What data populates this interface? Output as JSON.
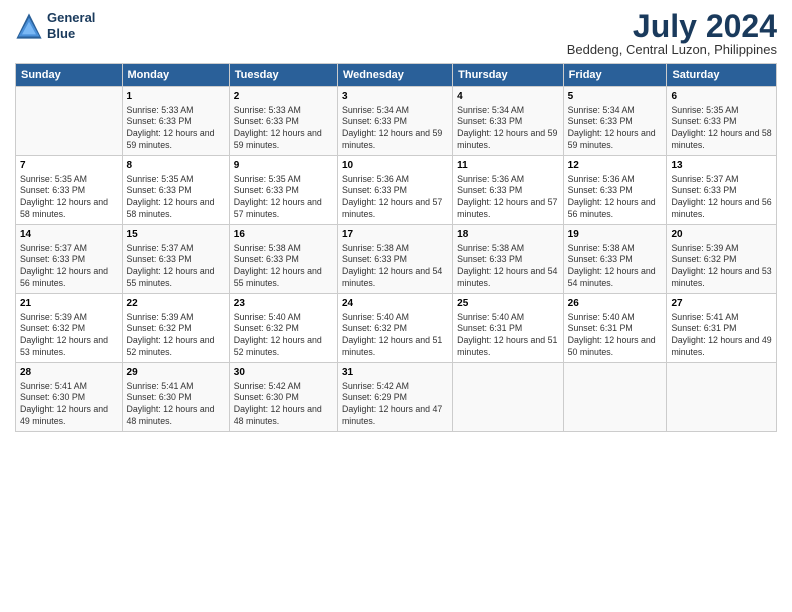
{
  "logo": {
    "line1": "General",
    "line2": "Blue"
  },
  "title": "July 2024",
  "subtitle": "Beddeng, Central Luzon, Philippines",
  "days_header": [
    "Sunday",
    "Monday",
    "Tuesday",
    "Wednesday",
    "Thursday",
    "Friday",
    "Saturday"
  ],
  "weeks": [
    [
      {
        "num": "",
        "sunrise": "",
        "sunset": "",
        "daylight": ""
      },
      {
        "num": "1",
        "sunrise": "Sunrise: 5:33 AM",
        "sunset": "Sunset: 6:33 PM",
        "daylight": "Daylight: 12 hours and 59 minutes."
      },
      {
        "num": "2",
        "sunrise": "Sunrise: 5:33 AM",
        "sunset": "Sunset: 6:33 PM",
        "daylight": "Daylight: 12 hours and 59 minutes."
      },
      {
        "num": "3",
        "sunrise": "Sunrise: 5:34 AM",
        "sunset": "Sunset: 6:33 PM",
        "daylight": "Daylight: 12 hours and 59 minutes."
      },
      {
        "num": "4",
        "sunrise": "Sunrise: 5:34 AM",
        "sunset": "Sunset: 6:33 PM",
        "daylight": "Daylight: 12 hours and 59 minutes."
      },
      {
        "num": "5",
        "sunrise": "Sunrise: 5:34 AM",
        "sunset": "Sunset: 6:33 PM",
        "daylight": "Daylight: 12 hours and 59 minutes."
      },
      {
        "num": "6",
        "sunrise": "Sunrise: 5:35 AM",
        "sunset": "Sunset: 6:33 PM",
        "daylight": "Daylight: 12 hours and 58 minutes."
      }
    ],
    [
      {
        "num": "7",
        "sunrise": "Sunrise: 5:35 AM",
        "sunset": "Sunset: 6:33 PM",
        "daylight": "Daylight: 12 hours and 58 minutes."
      },
      {
        "num": "8",
        "sunrise": "Sunrise: 5:35 AM",
        "sunset": "Sunset: 6:33 PM",
        "daylight": "Daylight: 12 hours and 58 minutes."
      },
      {
        "num": "9",
        "sunrise": "Sunrise: 5:35 AM",
        "sunset": "Sunset: 6:33 PM",
        "daylight": "Daylight: 12 hours and 57 minutes."
      },
      {
        "num": "10",
        "sunrise": "Sunrise: 5:36 AM",
        "sunset": "Sunset: 6:33 PM",
        "daylight": "Daylight: 12 hours and 57 minutes."
      },
      {
        "num": "11",
        "sunrise": "Sunrise: 5:36 AM",
        "sunset": "Sunset: 6:33 PM",
        "daylight": "Daylight: 12 hours and 57 minutes."
      },
      {
        "num": "12",
        "sunrise": "Sunrise: 5:36 AM",
        "sunset": "Sunset: 6:33 PM",
        "daylight": "Daylight: 12 hours and 56 minutes."
      },
      {
        "num": "13",
        "sunrise": "Sunrise: 5:37 AM",
        "sunset": "Sunset: 6:33 PM",
        "daylight": "Daylight: 12 hours and 56 minutes."
      }
    ],
    [
      {
        "num": "14",
        "sunrise": "Sunrise: 5:37 AM",
        "sunset": "Sunset: 6:33 PM",
        "daylight": "Daylight: 12 hours and 56 minutes."
      },
      {
        "num": "15",
        "sunrise": "Sunrise: 5:37 AM",
        "sunset": "Sunset: 6:33 PM",
        "daylight": "Daylight: 12 hours and 55 minutes."
      },
      {
        "num": "16",
        "sunrise": "Sunrise: 5:38 AM",
        "sunset": "Sunset: 6:33 PM",
        "daylight": "Daylight: 12 hours and 55 minutes."
      },
      {
        "num": "17",
        "sunrise": "Sunrise: 5:38 AM",
        "sunset": "Sunset: 6:33 PM",
        "daylight": "Daylight: 12 hours and 54 minutes."
      },
      {
        "num": "18",
        "sunrise": "Sunrise: 5:38 AM",
        "sunset": "Sunset: 6:33 PM",
        "daylight": "Daylight: 12 hours and 54 minutes."
      },
      {
        "num": "19",
        "sunrise": "Sunrise: 5:38 AM",
        "sunset": "Sunset: 6:33 PM",
        "daylight": "Daylight: 12 hours and 54 minutes."
      },
      {
        "num": "20",
        "sunrise": "Sunrise: 5:39 AM",
        "sunset": "Sunset: 6:32 PM",
        "daylight": "Daylight: 12 hours and 53 minutes."
      }
    ],
    [
      {
        "num": "21",
        "sunrise": "Sunrise: 5:39 AM",
        "sunset": "Sunset: 6:32 PM",
        "daylight": "Daylight: 12 hours and 53 minutes."
      },
      {
        "num": "22",
        "sunrise": "Sunrise: 5:39 AM",
        "sunset": "Sunset: 6:32 PM",
        "daylight": "Daylight: 12 hours and 52 minutes."
      },
      {
        "num": "23",
        "sunrise": "Sunrise: 5:40 AM",
        "sunset": "Sunset: 6:32 PM",
        "daylight": "Daylight: 12 hours and 52 minutes."
      },
      {
        "num": "24",
        "sunrise": "Sunrise: 5:40 AM",
        "sunset": "Sunset: 6:32 PM",
        "daylight": "Daylight: 12 hours and 51 minutes."
      },
      {
        "num": "25",
        "sunrise": "Sunrise: 5:40 AM",
        "sunset": "Sunset: 6:31 PM",
        "daylight": "Daylight: 12 hours and 51 minutes."
      },
      {
        "num": "26",
        "sunrise": "Sunrise: 5:40 AM",
        "sunset": "Sunset: 6:31 PM",
        "daylight": "Daylight: 12 hours and 50 minutes."
      },
      {
        "num": "27",
        "sunrise": "Sunrise: 5:41 AM",
        "sunset": "Sunset: 6:31 PM",
        "daylight": "Daylight: 12 hours and 49 minutes."
      }
    ],
    [
      {
        "num": "28",
        "sunrise": "Sunrise: 5:41 AM",
        "sunset": "Sunset: 6:30 PM",
        "daylight": "Daylight: 12 hours and 49 minutes."
      },
      {
        "num": "29",
        "sunrise": "Sunrise: 5:41 AM",
        "sunset": "Sunset: 6:30 PM",
        "daylight": "Daylight: 12 hours and 48 minutes."
      },
      {
        "num": "30",
        "sunrise": "Sunrise: 5:42 AM",
        "sunset": "Sunset: 6:30 PM",
        "daylight": "Daylight: 12 hours and 48 minutes."
      },
      {
        "num": "31",
        "sunrise": "Sunrise: 5:42 AM",
        "sunset": "Sunset: 6:29 PM",
        "daylight": "Daylight: 12 hours and 47 minutes."
      },
      {
        "num": "",
        "sunrise": "",
        "sunset": "",
        "daylight": ""
      },
      {
        "num": "",
        "sunrise": "",
        "sunset": "",
        "daylight": ""
      },
      {
        "num": "",
        "sunrise": "",
        "sunset": "",
        "daylight": ""
      }
    ]
  ]
}
